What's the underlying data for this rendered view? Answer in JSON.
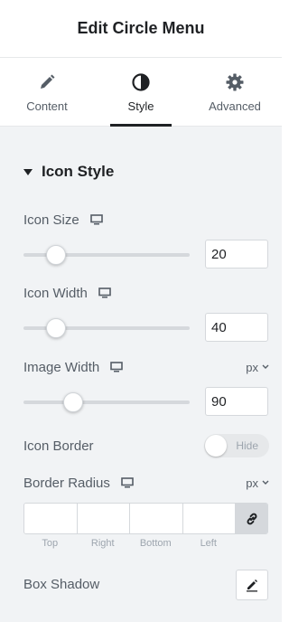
{
  "header": {
    "title": "Edit Circle Menu"
  },
  "tabs": [
    {
      "label": "Content",
      "icon": "pencil-icon"
    },
    {
      "label": "Style",
      "icon": "half-circle-icon",
      "active": true
    },
    {
      "label": "Advanced",
      "icon": "gear-icon"
    }
  ],
  "section": {
    "title": "Icon Style"
  },
  "controls": {
    "icon_size": {
      "label": "Icon Size",
      "value": "20"
    },
    "icon_width": {
      "label": "Icon Width",
      "value": "40"
    },
    "image_width": {
      "label": "Image Width",
      "value": "90",
      "unit": "px"
    },
    "icon_border": {
      "label": "Icon Border",
      "toggle_text": "Hide",
      "state": "off"
    },
    "border_radius": {
      "label": "Border Radius",
      "unit": "px",
      "sides": [
        "Top",
        "Right",
        "Bottom",
        "Left"
      ]
    },
    "box_shadow": {
      "label": "Box Shadow"
    }
  },
  "colors": {
    "accent": "#1f2124",
    "panel_bg": "#f1f3f5",
    "text": "#555d66"
  }
}
